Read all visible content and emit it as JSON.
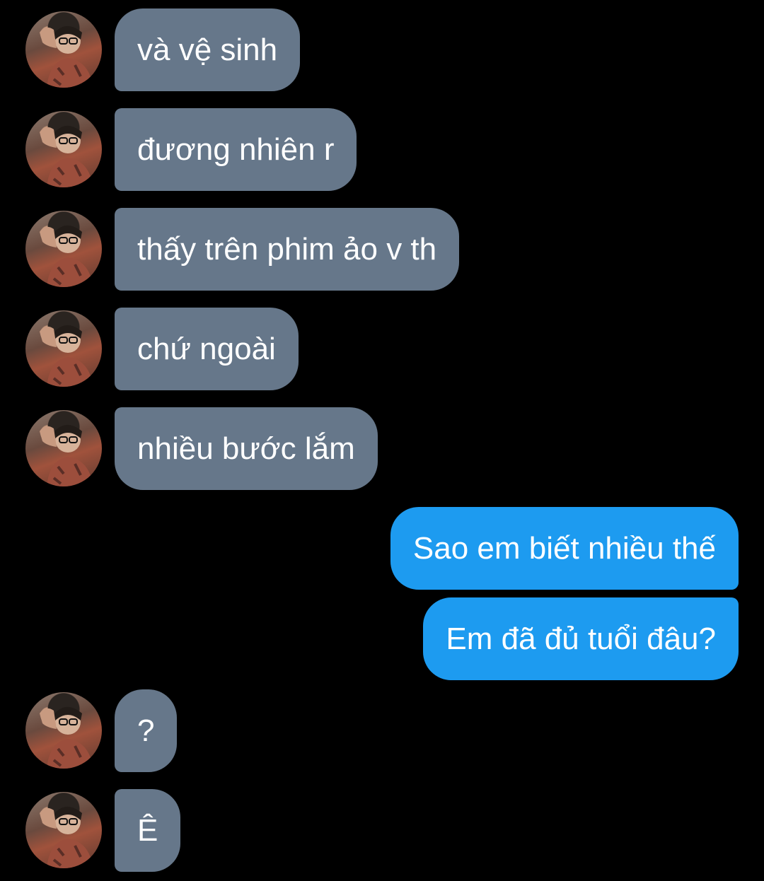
{
  "messages": [
    {
      "side": "in",
      "text": "và vệ sinh"
    },
    {
      "side": "in",
      "text": "đương nhiên r"
    },
    {
      "side": "in",
      "text": "thấy trên phim ảo v th"
    },
    {
      "side": "in",
      "text": "chứ ngoài"
    },
    {
      "side": "in",
      "text": "nhiều bước lắm"
    },
    {
      "side": "out",
      "text": "Sao em biết nhiều thế"
    },
    {
      "side": "out",
      "text": "Em đã đủ tuổi đâu?"
    },
    {
      "side": "in",
      "text": "?"
    },
    {
      "side": "in",
      "text": "Ê"
    }
  ],
  "colors": {
    "background": "#000000",
    "incoming_bubble": "#66778a",
    "outgoing_bubble": "#1d9bf0",
    "text": "#ffffff"
  },
  "icons": {
    "avatar": "profile-photo-avatar"
  }
}
